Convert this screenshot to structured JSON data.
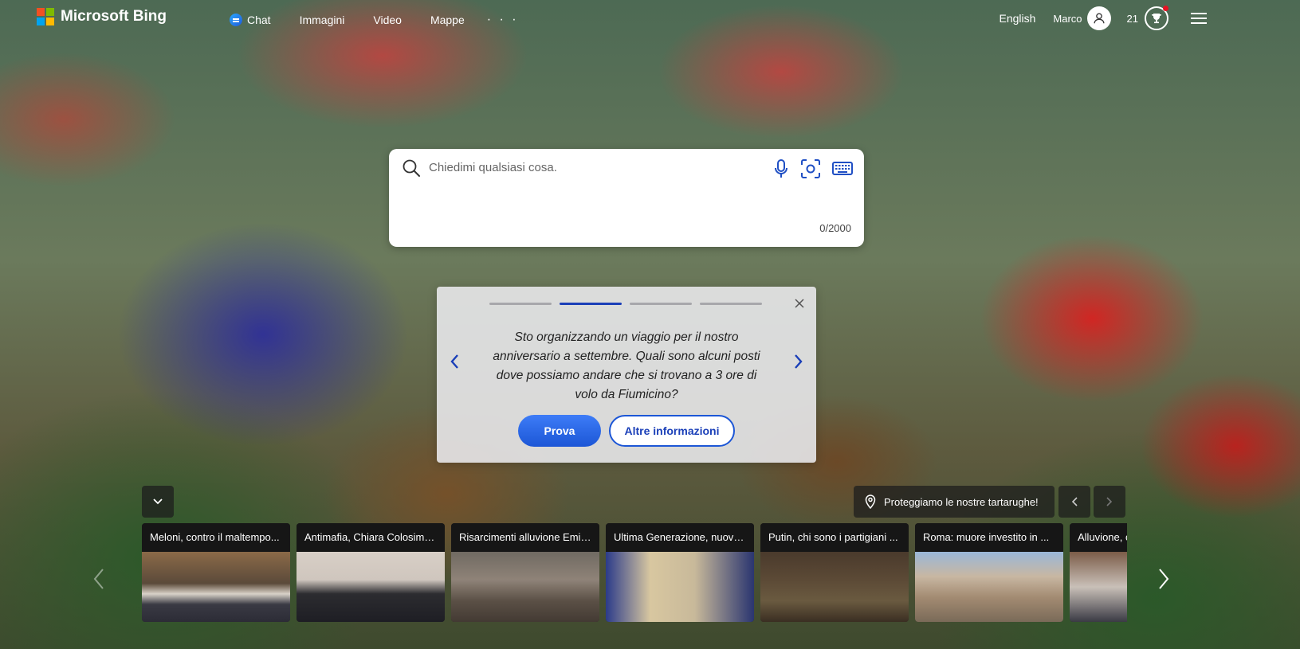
{
  "header": {
    "brand": "Microsoft Bing",
    "nav": [
      {
        "label": "Chat",
        "icon": "chat-icon"
      },
      {
        "label": "Immagini"
      },
      {
        "label": "Video"
      },
      {
        "label": "Mappe"
      }
    ],
    "more": "· · ·",
    "language": "English",
    "user_name": "Marco",
    "reward_points": "21"
  },
  "search": {
    "placeholder": "Chiedimi qualsiasi cosa.",
    "value": "",
    "counter": "0/2000"
  },
  "suggestion": {
    "prompt": "Sto organizzando un viaggio per il nostro anniversario a settembre. Quali sono alcuni posti dove possiamo andare che si trovano a 3 ore di volo da Fiumicino?",
    "try_label": "Prova",
    "more_label": "Altre informazioni",
    "steps_total": 4,
    "active_step": 2
  },
  "location": {
    "label": "Proteggiamo le nostre tartarughe!"
  },
  "news": [
    {
      "title": "Meloni, contro il maltempo..."
    },
    {
      "title": "Antimafia, Chiara Colosimo..."
    },
    {
      "title": "Risarcimenti alluvione Emili..."
    },
    {
      "title": "Ultima Generazione, nuovo..."
    },
    {
      "title": "Putin, chi sono i partigiani ..."
    },
    {
      "title": "Roma: muore investito in ..."
    },
    {
      "title": "Alluvione, c"
    }
  ],
  "colors": {
    "accent": "#1c56d6",
    "accent_dark": "#1a3fb8",
    "notification": "#e81123"
  }
}
